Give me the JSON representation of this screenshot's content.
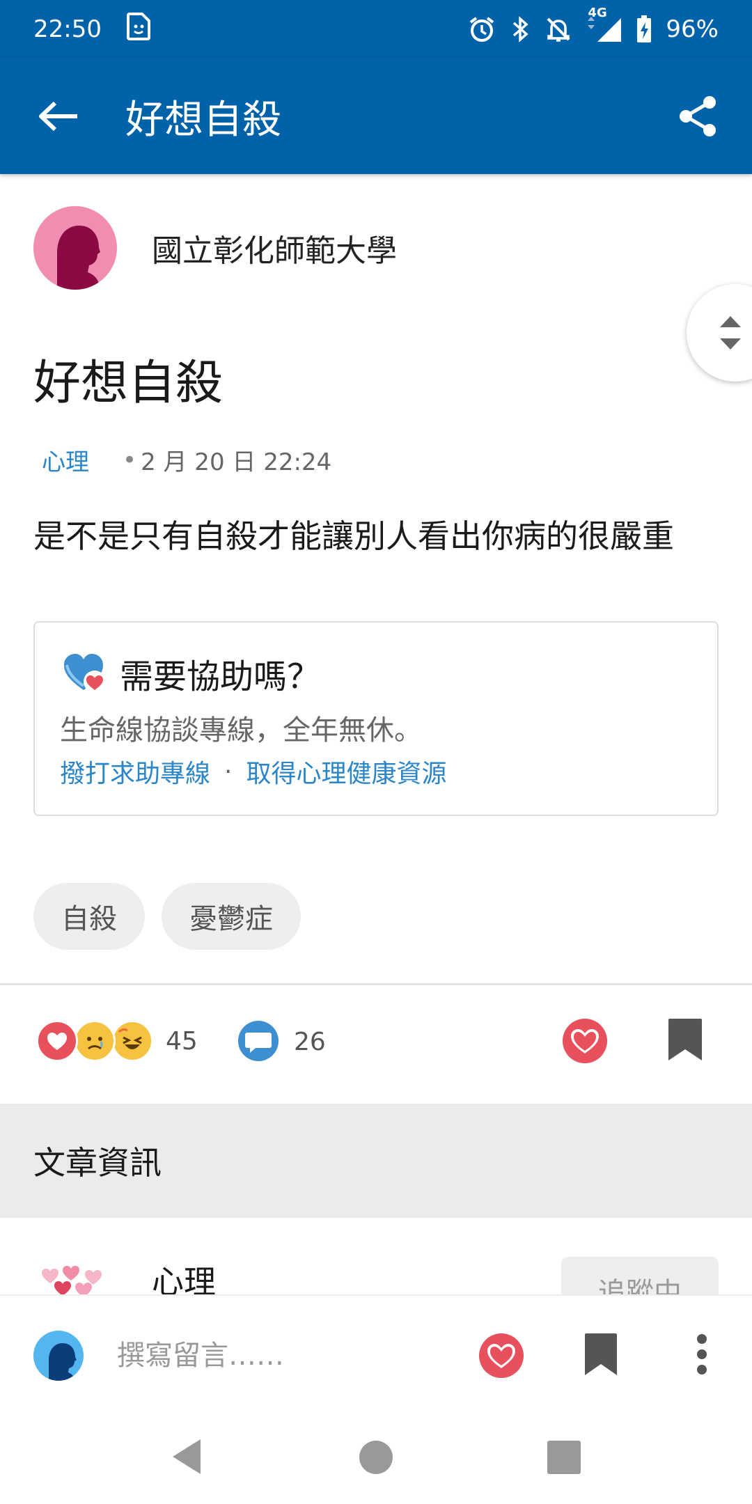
{
  "status_bar": {
    "time": "22:50",
    "network": "4G",
    "battery": "96%",
    "icons": [
      "sticker-icon",
      "alarm-icon",
      "bluetooth-icon",
      "notifications-off-icon",
      "signal-icon",
      "battery-charging-icon"
    ]
  },
  "app_bar": {
    "title": "好想自殺",
    "icons": [
      "back-arrow-icon",
      "share-icon"
    ]
  },
  "post": {
    "author": "國立彰化師範大學",
    "title": "好想自殺",
    "board": "心理",
    "date": "2 月 20 日 22:24",
    "body": "是不是只有自殺才能讓別人看出你病的很嚴重"
  },
  "help_card": {
    "title": "需要協助嗎？",
    "description": "生命線協談專線，全年無休。",
    "link_call": "撥打求助專線",
    "separator": "·",
    "link_resources": "取得心理健康資源"
  },
  "tags": [
    "自殺",
    "憂鬱症"
  ],
  "stats": {
    "reaction_count": "45",
    "comment_count": "26",
    "reaction_icons": [
      "heart-reaction-icon",
      "sad-face-icon",
      "laugh-face-icon"
    ]
  },
  "section": {
    "title": "文章資訊"
  },
  "board_info": {
    "name": "心理",
    "follow_label": "追蹤中"
  },
  "comment_bar": {
    "placeholder": "撰寫留言……"
  },
  "colors": {
    "brand": "#0062a8",
    "link": "#2a86c8",
    "like_red": "#e8505b",
    "avatar_pink": "#f28db2"
  }
}
